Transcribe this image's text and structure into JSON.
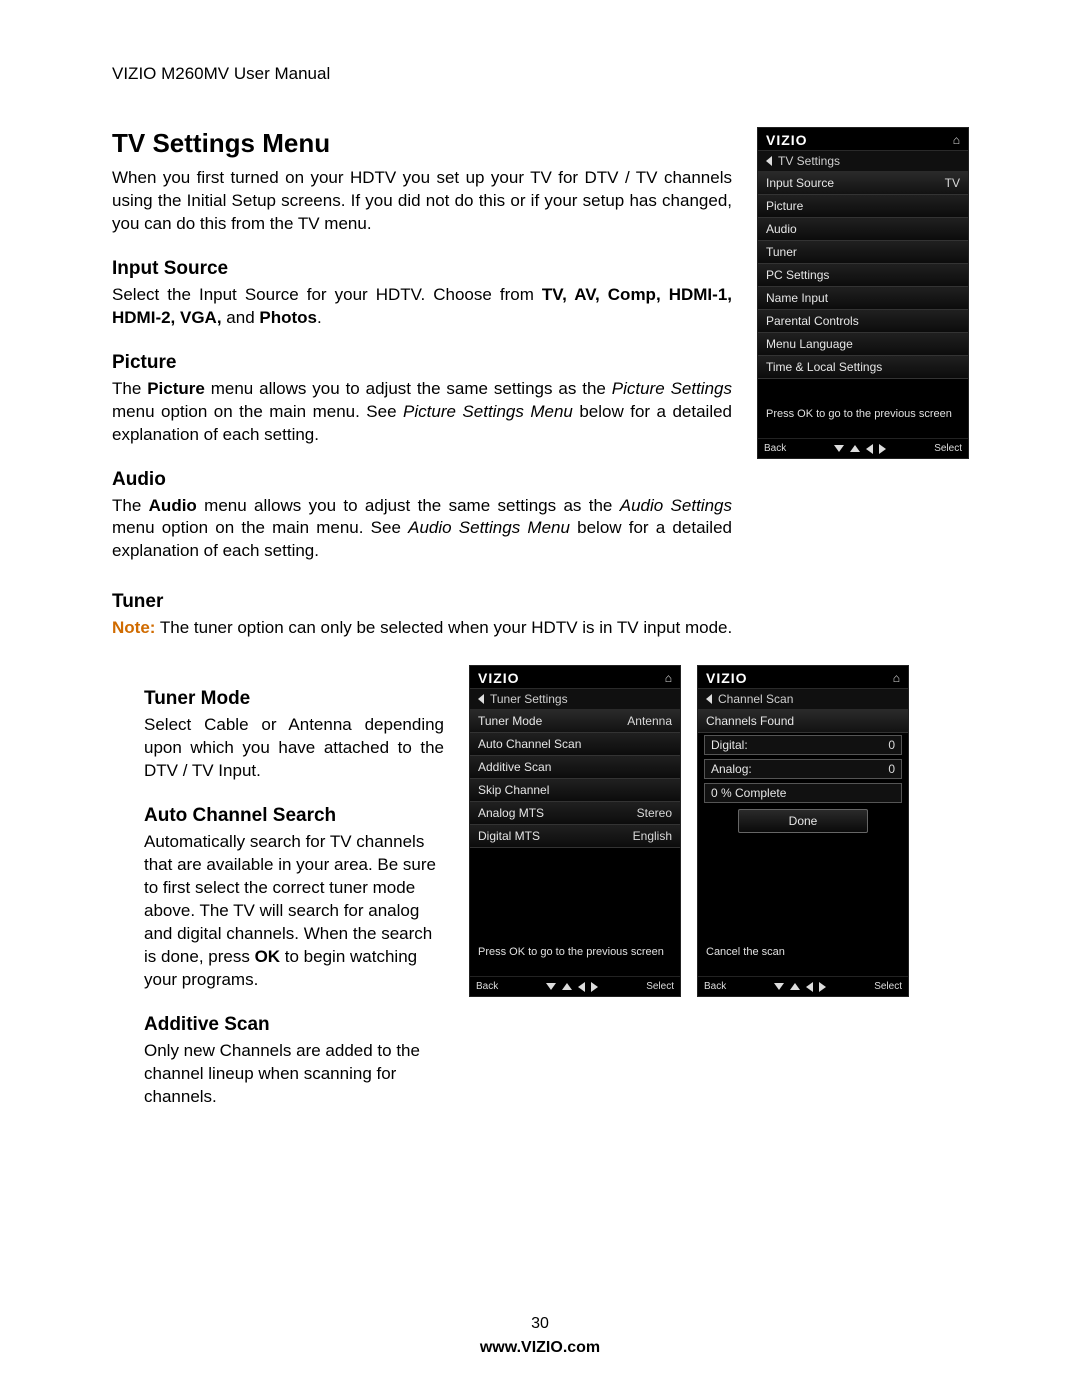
{
  "doc_header": "VIZIO M260MV User Manual",
  "page_number": "30",
  "footer_url": "www.VIZIO.com",
  "title": "TV Settings Menu",
  "intro": "When you first turned on your HDTV you set up your TV for DTV / TV channels using the Initial Setup screens. If you did not do this or if your setup has changed, you can do this from the TV menu.",
  "input_source": {
    "heading": "Input Source",
    "body_a": "Select the Input Source for your HDTV. Choose from ",
    "body_bold": "TV, AV, Comp, HDMI-1, HDMI-2, VGA,",
    "body_b": " and ",
    "body_bold2": "Photos",
    "body_c": "."
  },
  "picture": {
    "heading": "Picture",
    "body_a": "The ",
    "body_bold": "Picture",
    "body_b": " menu allows you to adjust the same settings as the ",
    "body_it1": "Picture Settings",
    "body_c": " menu option on the main menu. See ",
    "body_it2": "Picture Settings Menu",
    "body_d": " below for a detailed explanation of each setting."
  },
  "audio": {
    "heading": "Audio",
    "body_a": "The ",
    "body_bold": "Audio",
    "body_b": " menu allows you to adjust the same settings as the ",
    "body_it1": "Audio Settings",
    "body_c": " menu option on the main menu. See ",
    "body_it2": "Audio Settings Menu",
    "body_d": " below for a detailed explanation of each setting."
  },
  "tuner": {
    "heading": "Tuner",
    "note_label": "Note:",
    "note_body": " The tuner option can only be selected when your HDTV is in TV input mode."
  },
  "tuner_mode": {
    "heading": "Tuner Mode",
    "body": "Select Cable or Antenna depending upon which you have attached to the DTV / TV Input."
  },
  "auto_search": {
    "heading": "Auto Channel Search",
    "body_a": "Automatically search for TV channels that are available in your area. Be sure to first select the correct tuner mode above. The TV will search for analog and digital channels. When the search is done, press ",
    "body_bold": "OK",
    "body_b": " to begin watching your programs."
  },
  "additive": {
    "heading": "Additive Scan",
    "body": "Only new Channels are added to the channel lineup when scanning for channels."
  },
  "osd_common": {
    "logo": "VIZIO",
    "prev_msg": "Press OK to go to the previous screen",
    "cancel_msg": "Cancel the scan",
    "back": "Back",
    "select": "Select"
  },
  "osd1": {
    "crumb": "TV Settings",
    "rows": [
      {
        "label": "Input Source",
        "value": "TV"
      },
      {
        "label": "Picture"
      },
      {
        "label": "Audio"
      },
      {
        "label": "Tuner"
      },
      {
        "label": "PC Settings"
      },
      {
        "label": "Name Input"
      },
      {
        "label": "Parental Controls"
      },
      {
        "label": "Menu Language"
      },
      {
        "label": "Time & Local Settings"
      }
    ]
  },
  "osd2": {
    "crumb": "Tuner Settings",
    "rows": [
      {
        "label": "Tuner Mode",
        "value": "Antenna"
      },
      {
        "label": "Auto Channel Scan"
      },
      {
        "label": "Additive Scan"
      },
      {
        "label": "Skip Channel"
      },
      {
        "label": "Analog MTS",
        "value": "Stereo"
      },
      {
        "label": "Digital MTS",
        "value": "English"
      }
    ]
  },
  "osd3": {
    "crumb": "Channel Scan",
    "rows": [
      {
        "label": "Channels Found"
      },
      {
        "label": "Digital:",
        "value": "0",
        "field": true
      },
      {
        "label": "Analog:",
        "value": "0",
        "field": true
      },
      {
        "label": "0 % Complete",
        "field": true
      },
      {
        "label": "Done",
        "button": true
      }
    ]
  }
}
